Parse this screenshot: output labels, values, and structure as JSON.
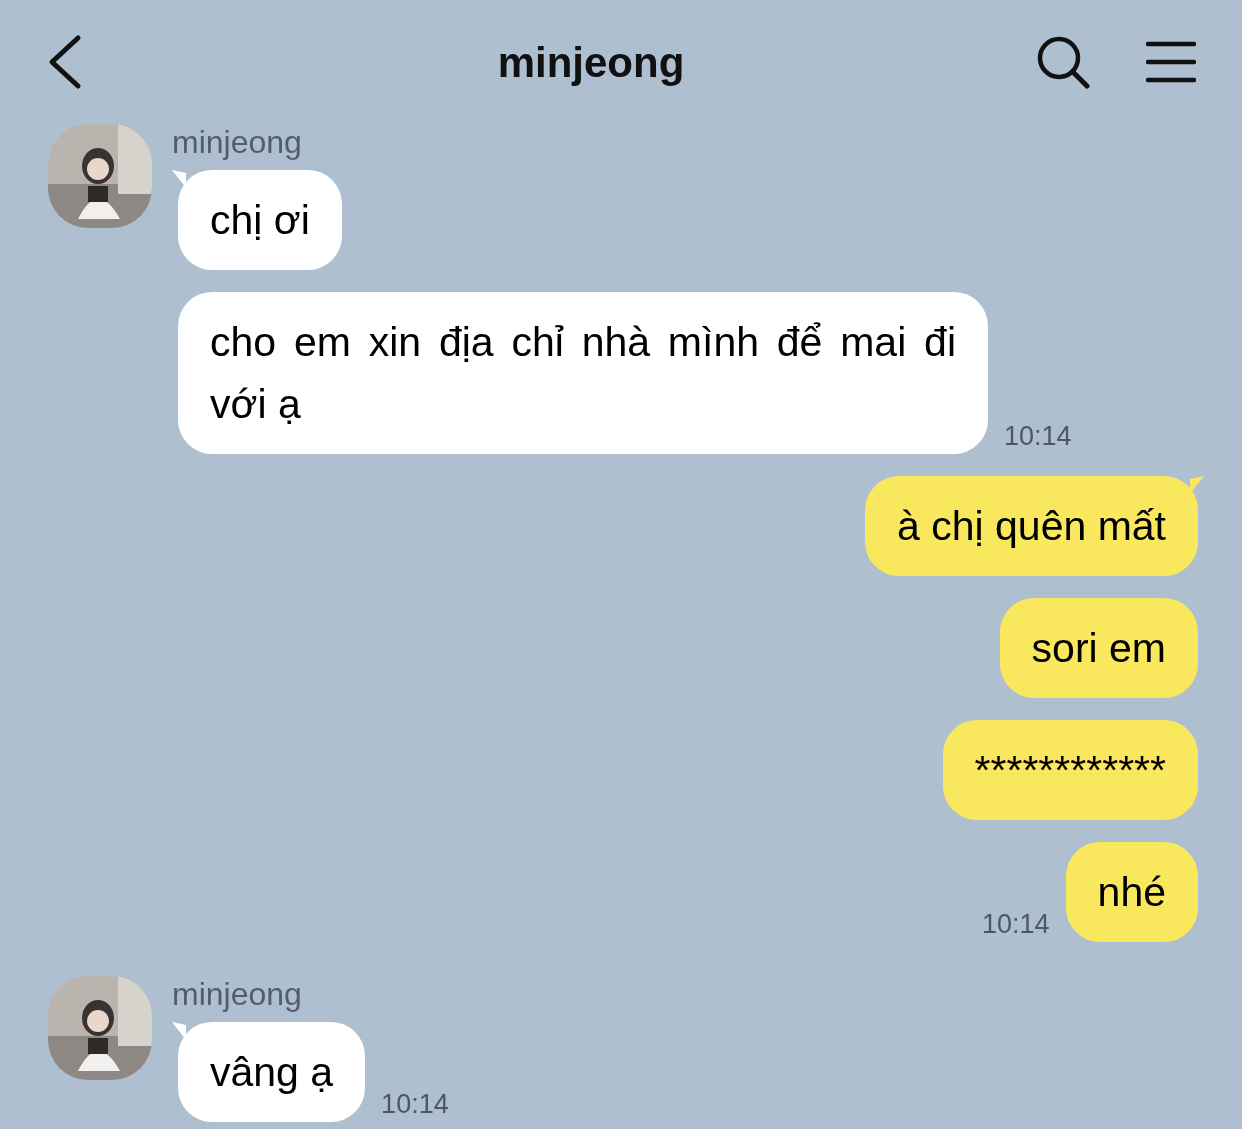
{
  "header": {
    "title": "minjeong"
  },
  "messages": [
    {
      "kind": "incoming",
      "sender": "minjeong",
      "bubbles": [
        "chị ơi",
        "cho em xin địa chỉ nhà mình để mai đi với ạ"
      ],
      "time": "10:14"
    },
    {
      "kind": "outgoing",
      "bubbles": [
        "à chị quên mất",
        "sori em",
        "************",
        "nhé"
      ],
      "time": "10:14"
    },
    {
      "kind": "incoming",
      "sender": "minjeong",
      "bubbles": [
        "vâng ạ"
      ],
      "time": "10:14"
    }
  ]
}
